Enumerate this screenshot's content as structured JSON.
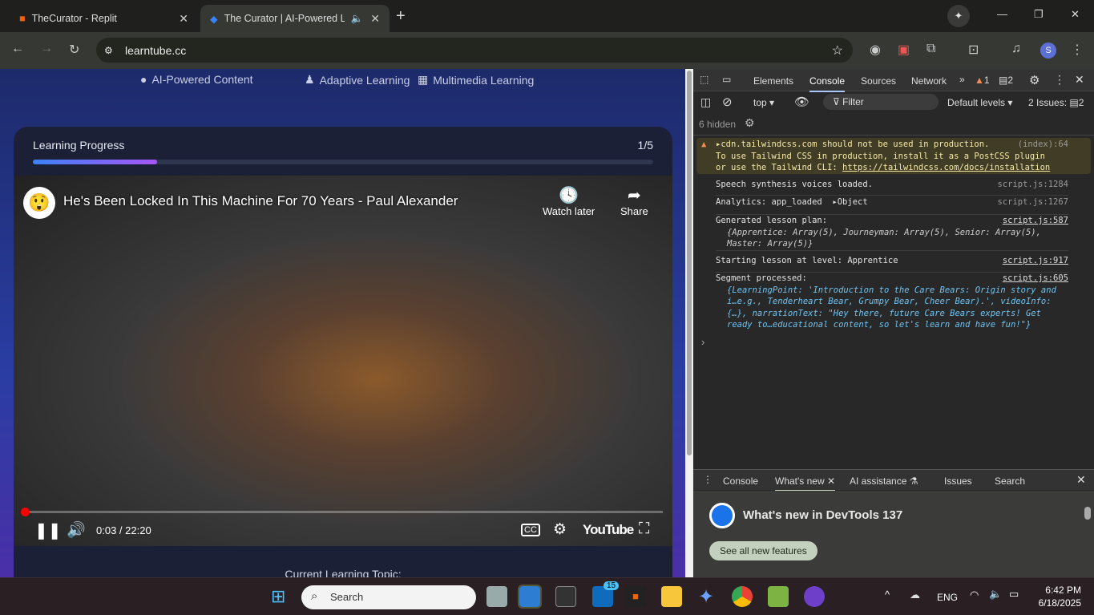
{
  "browser": {
    "tabs": [
      {
        "title": "TheCurator - Replit"
      },
      {
        "title": "The Curator | AI-Powered Le"
      }
    ],
    "url": "learntube.cc"
  },
  "site": {
    "features": [
      "AI-Powered Content",
      "Adaptive Learning",
      "Multimedia Learning"
    ],
    "progress": {
      "label": "Learning Progress",
      "count": "1/5",
      "percent": 20
    },
    "video": {
      "title": "He's Been Locked In This Machine For 70 Years - Paul Alexander",
      "watch_later": "Watch later",
      "share": "Share",
      "time": "0:03 / 22:20",
      "logo": "YouTube",
      "played_fraction": 0.002
    },
    "topic_label": "Current Learning Topic:"
  },
  "devtools": {
    "tabs": [
      "Elements",
      "Console",
      "Sources",
      "Network"
    ],
    "warnings": "1",
    "messages": "2",
    "context": "top",
    "filter_placeholder": "Filter",
    "levels": "Default levels",
    "issues": "2 Issues:",
    "issues_count": "2",
    "hidden": "6 hidden",
    "logs": [
      {
        "type": "warning",
        "text": "cdn.tailwindcss.com should not be used in production.",
        "line2": "To use Tailwind CSS in production, install it as a PostCSS plugin",
        "line3": "or use the Tailwind CLI: ",
        "link": "https://tailwindcss.com/docs/installation",
        "source": "(index):64"
      },
      {
        "text": "Speech synthesis voices loaded.",
        "source": "script.js:1284"
      },
      {
        "text": "Analytics: app_loaded",
        "obj": "Object",
        "source": "script.js:1267"
      },
      {
        "text": "Generated lesson plan:",
        "detail": "{Apprentice: Array(5), Journeyman: Array(5), Senior: Array(5), Master: Array(5)}",
        "source": "script.js:587"
      },
      {
        "text": "Starting lesson at level: Apprentice",
        "source": "script.js:917"
      },
      {
        "text": "Segment processed:",
        "detail": "{LearningPoint: 'Introduction to the Care Bears: Origin story and i…e.g., Tenderheart Bear, Grumpy Bear, Cheer Bear).', videoInfo: {…}, narrationText: \"Hey there, future Care Bears experts! Get ready to…educational content, so let's learn and have fun!\"}",
        "source": "script.js:605"
      }
    ],
    "drawer": {
      "tabs": [
        "Console",
        "What's new",
        "AI assistance",
        "Issues",
        "Search"
      ],
      "heading": "What's new in DevTools 137",
      "button": "See all new features"
    }
  },
  "taskbar": {
    "search": "Search",
    "badge": "15",
    "lang": "ENG",
    "time": "6:42 PM",
    "date": "6/18/2025"
  }
}
